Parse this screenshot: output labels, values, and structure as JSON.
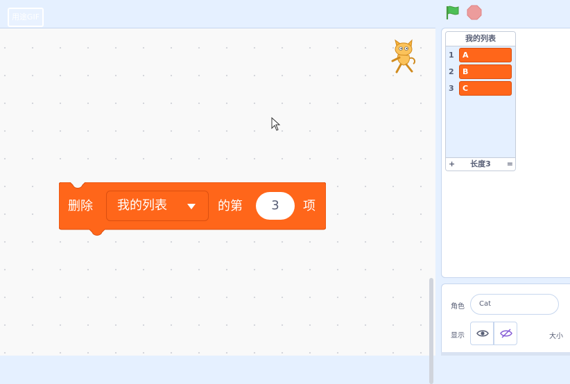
{
  "top": {
    "gif_badge": "用途GIF",
    "flag_icon": "green-flag-icon",
    "stop_icon": "stop-icon"
  },
  "block": {
    "delete_label": "删除",
    "list_name": "我的列表",
    "of_label": "的第",
    "index_value": "3",
    "item_label": "项",
    "color": "#ff661a"
  },
  "list_monitor": {
    "title": "我的列表",
    "items": [
      {
        "index": "1",
        "value": "A"
      },
      {
        "index": "2",
        "value": "B"
      },
      {
        "index": "3",
        "value": "C"
      }
    ],
    "add_label": "+",
    "length_label": "长度3",
    "resize_label": "="
  },
  "sprite_info": {
    "sprite_label": "角色",
    "sprite_name": "Cat",
    "show_label": "显示",
    "size_label": "大小"
  }
}
